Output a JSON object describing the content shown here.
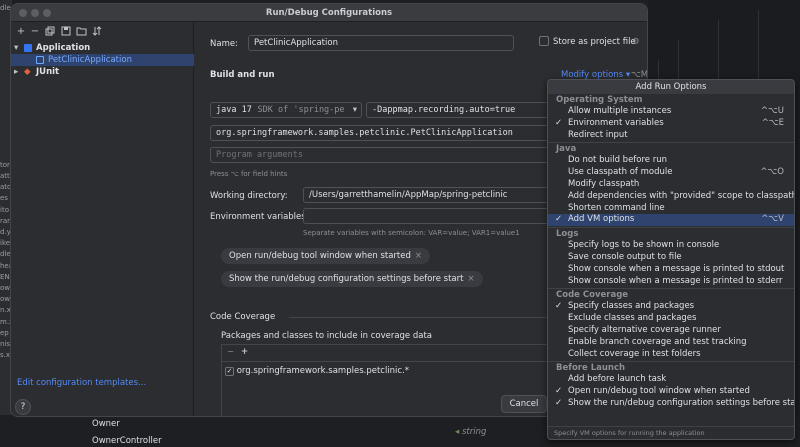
{
  "window": {
    "title": "Run/Debug Configurations"
  },
  "toolbar": {
    "add": "+",
    "remove": "−"
  },
  "tree": {
    "application": "Application",
    "pet_clinic": "PetClinicApplication",
    "junit": "JUnit"
  },
  "left_footer": {
    "edit_templates": "Edit configuration templates..."
  },
  "form": {
    "name_label": "Name:",
    "name_value": "PetClinicApplication",
    "store_project_file": "Store as project file",
    "build_and_run": "Build and run",
    "modify_options": "Modify options",
    "modify_options_shortcut": "⌥M",
    "jdk_name": "java 17",
    "jdk_detail": "SDK of 'spring-pe",
    "vm_options": "-Dappmap.recording.auto=true",
    "main_class": "org.springframework.samples.petclinic.PetClinicApplication",
    "program_args_placeholder": "Program arguments",
    "field_hints": "Press ⌥ for field hints",
    "working_dir_label": "Working directory:",
    "working_dir_value": "/Users/garretthamelin/AppMap/spring-petclinic",
    "env_vars_label": "Environment variables:",
    "env_vars_hint": "Separate variables with semicolon: VAR=value; VAR1=value1",
    "chip_tool_window": "Open run/debug tool window when started",
    "chip_show_settings": "Show the run/debug configuration settings before start",
    "chip_close": "×",
    "code_coverage": "Code Coverage",
    "coverage_packages_label": "Packages and classes to include in coverage data",
    "coverage_add": "+",
    "coverage_remove": "−",
    "coverage_entry": "org.springframework.samples.petclinic.*",
    "cancel": "Cancel",
    "help": "?"
  },
  "popup": {
    "title": "Add Run Options",
    "groups": [
      {
        "label": "Operating System",
        "items": [
          {
            "label": "Allow multiple instances",
            "checked": false,
            "shortcut": "^⌥U"
          },
          {
            "label": "Environment variables",
            "checked": true,
            "shortcut": "^⌥E"
          },
          {
            "label": "Redirect input",
            "checked": false,
            "shortcut": ""
          }
        ]
      },
      {
        "label": "Java",
        "items": [
          {
            "label": "Do not build before run",
            "checked": false,
            "shortcut": ""
          },
          {
            "label": "Use classpath of module",
            "checked": false,
            "shortcut": "^⌥O"
          },
          {
            "label": "Modify classpath",
            "checked": false,
            "shortcut": ""
          },
          {
            "label": "Add dependencies with \"provided\" scope to classpath",
            "checked": false,
            "shortcut": ""
          },
          {
            "label": "Shorten command line",
            "checked": false,
            "shortcut": ""
          },
          {
            "label": "Add VM options",
            "checked": true,
            "shortcut": "^⌥V",
            "selected": true
          }
        ]
      },
      {
        "label": "Logs",
        "items": [
          {
            "label": "Specify logs to be shown in console",
            "checked": false,
            "shortcut": ""
          },
          {
            "label": "Save console output to file",
            "checked": false,
            "shortcut": ""
          },
          {
            "label": "Show console when a message is printed to stdout",
            "checked": false,
            "shortcut": ""
          },
          {
            "label": "Show console when a message is printed to stderr",
            "checked": false,
            "shortcut": ""
          }
        ]
      },
      {
        "label": "Code Coverage",
        "items": [
          {
            "label": "Specify classes and packages",
            "checked": true,
            "shortcut": ""
          },
          {
            "label": "Exclude classes and packages",
            "checked": false,
            "shortcut": ""
          },
          {
            "label": "Specify alternative coverage runner",
            "checked": false,
            "shortcut": ""
          },
          {
            "label": "Enable branch coverage and test tracking",
            "checked": false,
            "shortcut": ""
          },
          {
            "label": "Collect coverage in test folders",
            "checked": false,
            "shortcut": ""
          }
        ]
      },
      {
        "label": "Before Launch",
        "items": [
          {
            "label": "Add before launch task",
            "checked": false,
            "shortcut": ""
          },
          {
            "label": "Open run/debug tool window when started",
            "checked": true,
            "shortcut": ""
          },
          {
            "label": "Show the run/debug configuration settings before start",
            "checked": true,
            "shortcut": ""
          }
        ]
      }
    ],
    "footer": "Specify VM options for running the application",
    "check_glyph": "✓"
  },
  "background": {
    "owner": "Owner",
    "owner_controller": "OwnerController",
    "string_hint": "string",
    "left_edge": [
      "dle",
      "",
      "",
      "",
      "",
      "",
      "",
      "",
      "",
      "",
      "",
      "",
      "",
      "",
      "tor",
      "att",
      "ato",
      "es",
      "ito",
      "ran",
      "d.y",
      "ike",
      "dle",
      "hea",
      "EN",
      "ow",
      "ow",
      "n.x",
      "m.x",
      "ep",
      "nis",
      "s.x"
    ]
  }
}
